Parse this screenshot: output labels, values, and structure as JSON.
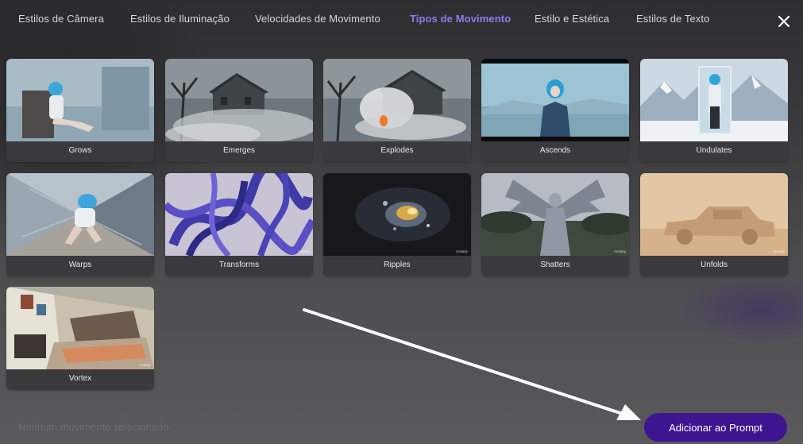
{
  "tabs": [
    {
      "label": "Estilos de Câmera"
    },
    {
      "label": "Estilos de Iluminação"
    },
    {
      "label": "Velocidades de Movimento"
    },
    {
      "label": "Tipos de Movimento"
    },
    {
      "label": "Estilo e Estética"
    },
    {
      "label": "Estilos de Texto"
    }
  ],
  "active_tab": "Tipos de Movimento",
  "close_icon": "close-icon",
  "motions": [
    {
      "label": "Grows"
    },
    {
      "label": "Emerges"
    },
    {
      "label": "Explodes"
    },
    {
      "label": "Ascends"
    },
    {
      "label": "Undulates"
    },
    {
      "label": "Warps"
    },
    {
      "label": "Transforms"
    },
    {
      "label": "Ripples"
    },
    {
      "label": "Shatters"
    },
    {
      "label": "Unfolds"
    },
    {
      "label": "Vortex"
    }
  ],
  "footer": {
    "status": "Nenhum movimento selecionado",
    "add_button": "Adicionar ao Prompt"
  },
  "colors": {
    "accent": "#8b7cf0",
    "button": "#3d1591"
  }
}
